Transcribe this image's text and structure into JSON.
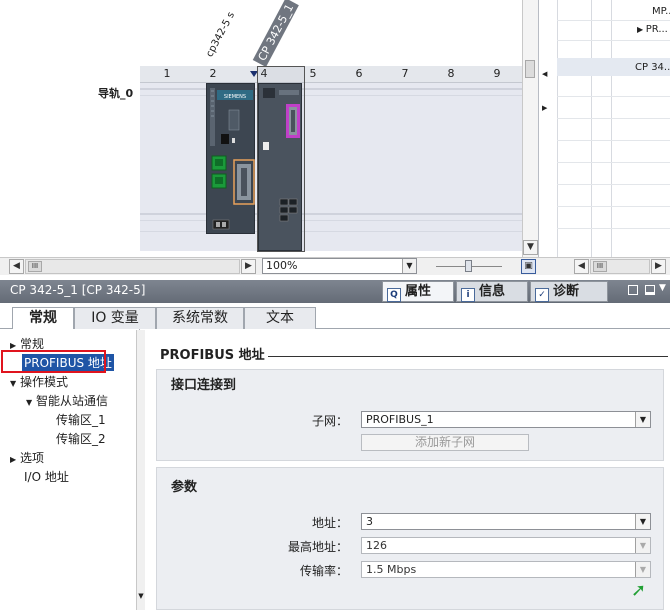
{
  "device_view": {
    "slots": [
      "1",
      "2",
      "4",
      "5",
      "6",
      "7",
      "8",
      "9"
    ],
    "rail_label": "导轨_0",
    "cpu_label": "cp342-5 s",
    "cp_label": "CP 342-5_1",
    "cpu_brand": "SIEMENS"
  },
  "right_panel": {
    "row1": "MP..",
    "row2": "PR...",
    "row3": "CP 34..."
  },
  "zoom": {
    "value": "100%"
  },
  "properties": {
    "title": "CP 342-5_1 [CP 342-5]",
    "tabs": [
      {
        "label": "属性",
        "icon": "properties-icon"
      },
      {
        "label": "信息",
        "icon": "info-icon"
      },
      {
        "label": "诊断",
        "icon": "diagnostics-icon"
      }
    ]
  },
  "sub_tabs": [
    "常规",
    "IO 变量",
    "系统常数",
    "文本"
  ],
  "nav": {
    "general": "常规",
    "profibus": "PROFIBUS 地址",
    "op_mode": "操作模式",
    "slave_comm": "智能从站通信",
    "transfer1": "传输区_1",
    "transfer2": "传输区_2",
    "options": "选项",
    "io_address": "I/O 地址"
  },
  "content": {
    "section_title": "PROFIBUS 地址",
    "interface_group": {
      "title": "接口连接到",
      "subnet_label": "子网：",
      "subnet_value": "PROFIBUS_1",
      "add_subnet_button": "添加新子网"
    },
    "params_group": {
      "title": "参数",
      "address_label": "地址：",
      "address_value": "3",
      "highest_label": "最高地址：",
      "highest_value": "126",
      "rate_label": "传输率：",
      "rate_value": "1.5 Mbps"
    }
  },
  "colors": {
    "accent": "#1f55a6",
    "highlight_box": "#e0141e",
    "header_bg": "#727985"
  }
}
